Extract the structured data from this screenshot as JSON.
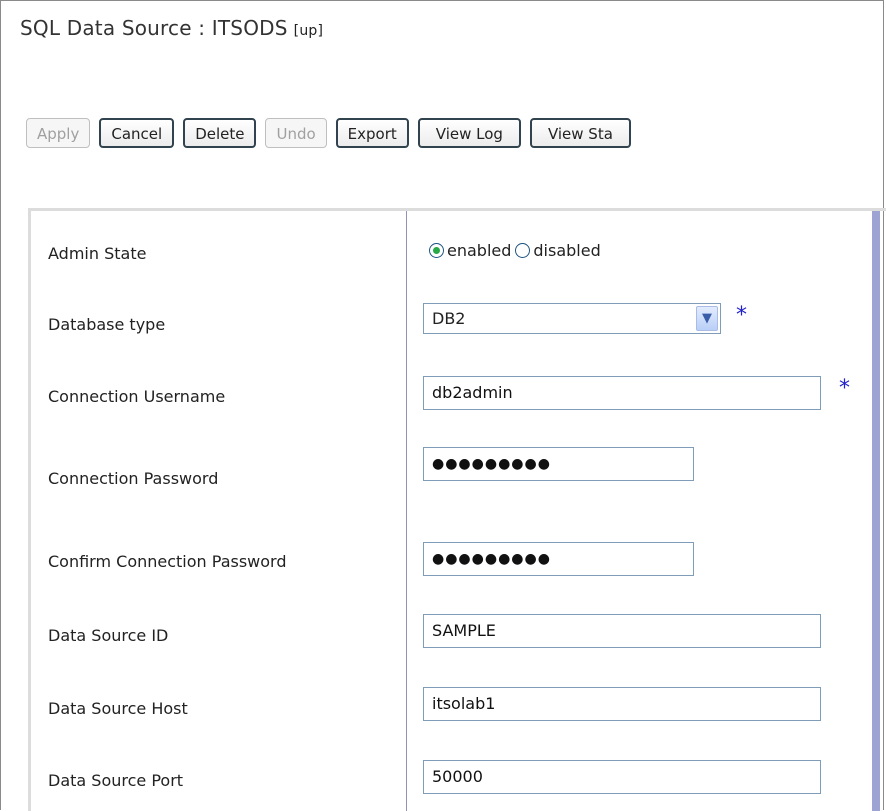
{
  "header": {
    "title": "SQL Data Source : ITSODS",
    "status": "[up]"
  },
  "toolbar": {
    "apply": "Apply",
    "cancel": "Cancel",
    "delete": "Delete",
    "undo": "Undo",
    "export": "Export",
    "view_log": "View Log",
    "view_status": "View Sta"
  },
  "form": {
    "admin_state": {
      "label": "Admin State",
      "options": [
        "enabled",
        "disabled"
      ],
      "selected": "enabled"
    },
    "database_type": {
      "label": "Database type",
      "value": "DB2",
      "required": "*"
    },
    "connection_username": {
      "label": "Connection Username",
      "value": "db2admin",
      "required": "*"
    },
    "connection_password": {
      "label": "Connection Password",
      "value": "●●●●●●●●●"
    },
    "confirm_password": {
      "label": "Confirm Connection Password",
      "value": "●●●●●●●●●"
    },
    "data_source_id": {
      "label": "Data Source ID",
      "value": "SAMPLE"
    },
    "data_source_host": {
      "label": "Data Source Host",
      "value": "itsolab1"
    },
    "data_source_port": {
      "label": "Data Source Port",
      "value": "50000"
    }
  },
  "colors": {
    "required_star": "#2222cc",
    "radio_selected": "#28a846",
    "panel_rule": "#9da3d2"
  },
  "icons": {
    "dropdown": "chevron-down-icon"
  }
}
